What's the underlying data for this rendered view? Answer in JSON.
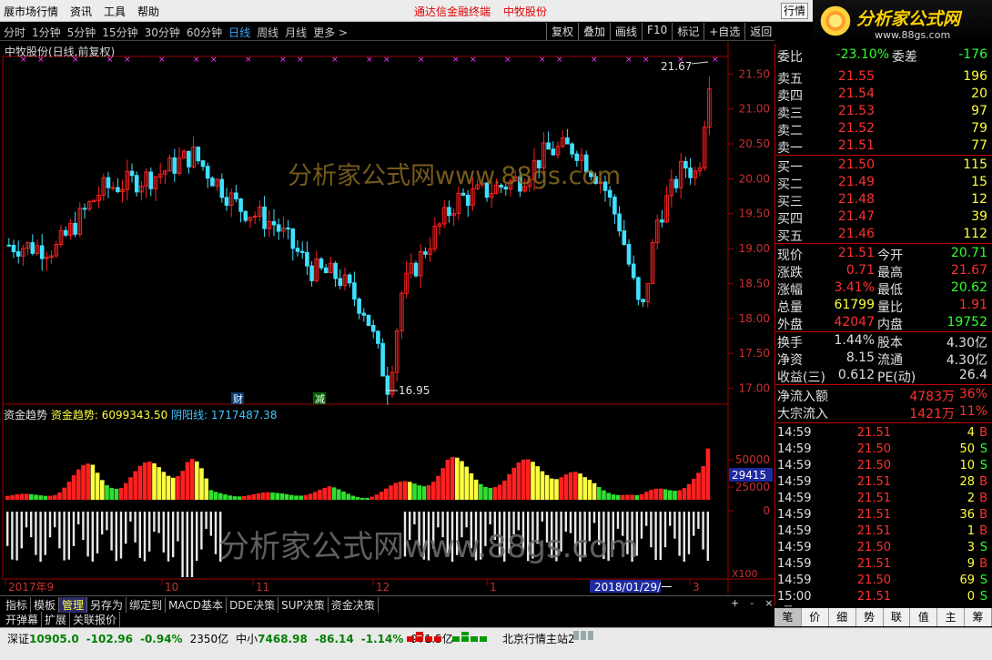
{
  "titlebar": {
    "menu": [
      "展市场行情",
      "资讯",
      "工具",
      "帮助"
    ],
    "center_links": [
      "通达信金融终端",
      "中牧股份"
    ],
    "right_button": "行情"
  },
  "logo": {
    "text": "分析家公式网",
    "url_text": "www.88gs.com"
  },
  "toolbar": {
    "periods": [
      "分时",
      "1分钟",
      "5分钟",
      "15分钟",
      "30分钟",
      "60分钟",
      "日线",
      "周线",
      "月线",
      "更多 >"
    ],
    "active_period": "日线",
    "buttons": [
      "复权",
      "叠加",
      "画线",
      "F10",
      "标记",
      "+自选",
      "返回"
    ]
  },
  "chart": {
    "stock_title": "中牧股份(日线,前复权)",
    "price_axis": [
      "21.50",
      "21.00",
      "20.50",
      "20.00",
      "19.50",
      "19.00",
      "18.50",
      "18.00",
      "17.50",
      "17.00"
    ],
    "high_label": "21.67",
    "low_label": "16.95",
    "event_marks": [
      "财",
      "减"
    ],
    "indicator_name": "资金趋势",
    "indicator_line1": "资金趋势: 6099343.50",
    "indicator_line2": "阴阳线: 1717487.38",
    "indicator_axis": [
      "50000",
      "25000",
      "0"
    ],
    "indicator_current": "29415",
    "indicator_scale": "X100",
    "date_axis": [
      "2017年9",
      "10",
      "11",
      "12",
      "1",
      "2018/01/29/一",
      "3"
    ],
    "watermark_top": "分析家公式网www.88gs.com",
    "watermark_bottom": "分析家公式网www.88gs.com",
    "colors": {
      "up": "#ff2020",
      "down": "#40e0ff",
      "signal": "#ff40ff",
      "yellow": "#ffff40",
      "green": "#30e030"
    }
  },
  "bottom_tabs": {
    "row1": [
      "指标",
      "模板",
      "管理",
      "另存为",
      "绑定到",
      "MACD基本",
      "DDE决策",
      "SUP决策",
      "资金决策"
    ],
    "selected": "管理",
    "row2": [
      "开弹幕",
      "扩展",
      "关联报价"
    ],
    "controls": [
      "+",
      "-",
      "×",
      "⊠"
    ]
  },
  "quote": {
    "weibi": {
      "label": "委比",
      "value": "-23.10%",
      "label2": "委差",
      "value2": "-176"
    },
    "sell": [
      {
        "label": "卖五",
        "price": "21.55",
        "vol": "196"
      },
      {
        "label": "卖四",
        "price": "21.54",
        "vol": "20"
      },
      {
        "label": "卖三",
        "price": "21.53",
        "vol": "97"
      },
      {
        "label": "卖二",
        "price": "21.52",
        "vol": "79"
      },
      {
        "label": "卖一",
        "price": "21.51",
        "vol": "77"
      }
    ],
    "buy": [
      {
        "label": "买一",
        "price": "21.50",
        "vol": "115"
      },
      {
        "label": "买二",
        "price": "21.49",
        "vol": "15"
      },
      {
        "label": "买三",
        "price": "21.48",
        "vol": "12"
      },
      {
        "label": "买四",
        "price": "21.47",
        "vol": "39"
      },
      {
        "label": "买五",
        "price": "21.46",
        "vol": "112"
      }
    ],
    "stats": [
      {
        "l1": "现价",
        "v1": "21.51",
        "l2": "今开",
        "v2": "20.71"
      },
      {
        "l1": "涨跌",
        "v1": "0.71",
        "l2": "最高",
        "v2": "21.67"
      },
      {
        "l1": "涨幅",
        "v1": "3.41%",
        "l2": "最低",
        "v2": "20.62"
      },
      {
        "l1": "总量",
        "v1": "61799",
        "l2": "量比",
        "v2": "1.91"
      },
      {
        "l1": "外盘",
        "v1": "42047",
        "l2": "内盘",
        "v2": "19752"
      }
    ],
    "stats2": [
      {
        "l1": "换手",
        "v1": "1.44%",
        "l2": "股本",
        "v2": "4.30亿"
      },
      {
        "l1": "净资",
        "v1": "8.15",
        "l2": "流通",
        "v2": "4.30亿"
      },
      {
        "l1": "收益(三)",
        "v1": "0.612",
        "l2": "PE(动)",
        "v2": "26.4"
      }
    ],
    "flow": [
      {
        "label": "净流入额",
        "value": "4783万",
        "pct": "36%"
      },
      {
        "label": "大宗流入",
        "value": "1421万",
        "pct": "11%"
      }
    ],
    "ticks": [
      {
        "time": "14:59",
        "price": "21.51",
        "vol": "4",
        "dir": "B"
      },
      {
        "time": "14:59",
        "price": "21.50",
        "vol": "50",
        "dir": "S"
      },
      {
        "time": "14:59",
        "price": "21.50",
        "vol": "10",
        "dir": "S"
      },
      {
        "time": "14:59",
        "price": "21.51",
        "vol": "28",
        "dir": "B"
      },
      {
        "time": "14:59",
        "price": "21.51",
        "vol": "2",
        "dir": "B"
      },
      {
        "time": "14:59",
        "price": "21.51",
        "vol": "36",
        "dir": "B"
      },
      {
        "time": "14:59",
        "price": "21.51",
        "vol": "1",
        "dir": "B"
      },
      {
        "time": "14:59",
        "price": "21.50",
        "vol": "3",
        "dir": "S"
      },
      {
        "time": "14:59",
        "price": "21.51",
        "vol": "9",
        "dir": "B"
      },
      {
        "time": "14:59",
        "price": "21.50",
        "vol": "69",
        "dir": "S"
      },
      {
        "time": "15:00",
        "price": "21.51",
        "vol": "0",
        "dir": "S"
      }
    ],
    "tabs": [
      "笔",
      "价",
      "细",
      "势",
      "联",
      "值",
      "主",
      "筹"
    ]
  },
  "status": {
    "sz_label": "深证",
    "sz_value": "10905.0",
    "sz_change": "-102.96",
    "sz_pct": "-0.94%",
    "sz_amount": "2350亿",
    "zx_label": "中小",
    "zx_value": "7468.98",
    "zx_change": "-86.14",
    "zx_pct": "-1.14%",
    "zx_amount": "971.5亿",
    "server": "北京行情主站2"
  }
}
